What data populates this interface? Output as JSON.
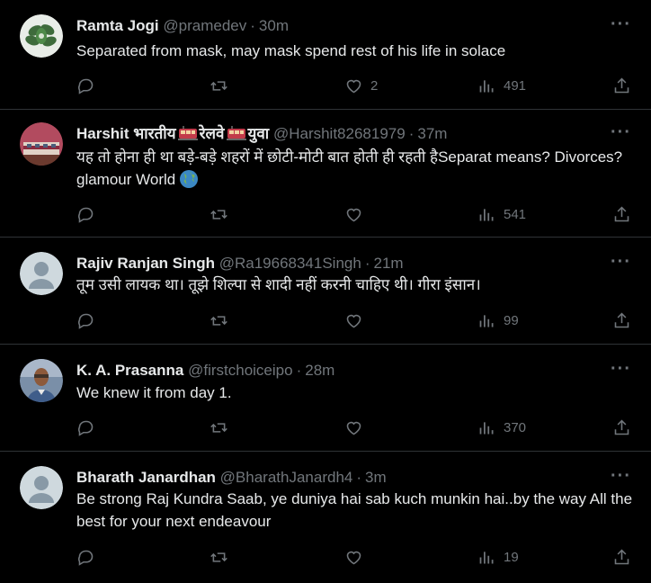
{
  "tweets": [
    {
      "name": "Ramta Jogi",
      "handle": "@pramedev",
      "time": "30m",
      "text": "Separated from mask, may mask spend rest of his life in solace",
      "likes": "2",
      "views": "491",
      "avatar": "plant"
    },
    {
      "name": "Harshit भारतीय",
      "name_mid": "रेलवे",
      "name_end": "युवा",
      "handle": "@Harshit82681979",
      "time": "37m",
      "text": "यह तो होना ही था बड़े-बड़े शहरों में छोटी-मोटी बात होती ही रहती हैSeparat means? Divorces? glamour World",
      "likes": "",
      "views": "541",
      "avatar": "train"
    },
    {
      "name": "Rajiv Ranjan Singh",
      "handle": "@Ra19668341Singh",
      "time": "21m",
      "text": "तूम उसी लायक था। तूझे शिल्पा से शादी नहीं करनी चाहिए थी। गीरा इंसान।",
      "likes": "",
      "views": "99",
      "avatar": "default"
    },
    {
      "name": "K. A. Prasanna",
      "handle": "@firstchoiceipo",
      "time": "28m",
      "text": "We knew it from day 1.",
      "likes": "",
      "views": "370",
      "avatar": "person"
    },
    {
      "name": "Bharath Janardhan",
      "handle": "@BharathJanardh4",
      "time": "3m",
      "text": "Be strong Raj Kundra Saab, ye duniya hai sab kuch munkin hai..by the way All the best for your next endeavour",
      "likes": "",
      "views": "19",
      "avatar": "default"
    }
  ],
  "separator": "·",
  "icons": {
    "more": "more-dots-icon",
    "reply": "reply-bubble-icon",
    "retweet": "retweet-icon",
    "like": "heart-icon",
    "views": "views-bar-chart-icon",
    "share": "share-upload-icon",
    "flag": "train-emoji-icon",
    "globe": "globe-emoji-icon"
  },
  "colors": {
    "background": "#000000",
    "text": "#e7e9ea",
    "muted": "#71767b",
    "divider": "#2f3336"
  }
}
